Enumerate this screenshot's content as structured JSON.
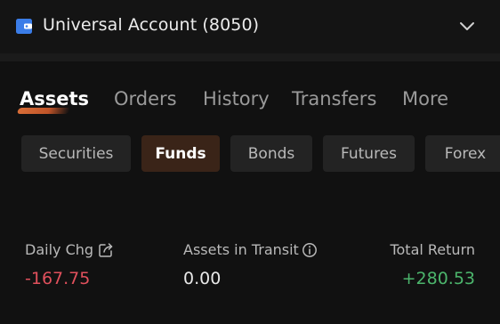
{
  "header": {
    "account_title": "Universal Account (8050)",
    "icons": {
      "wallet": "wallet-icon",
      "expand": "chevron-down-icon"
    },
    "accent_color": "#3b7de8"
  },
  "tabs": [
    {
      "label": "Assets",
      "active": true
    },
    {
      "label": "Orders",
      "active": false
    },
    {
      "label": "History",
      "active": false
    },
    {
      "label": "Transfers",
      "active": false
    },
    {
      "label": "More",
      "active": false
    }
  ],
  "categories": [
    {
      "label": "Securities",
      "active": false
    },
    {
      "label": "Funds",
      "active": true
    },
    {
      "label": "Bonds",
      "active": false
    },
    {
      "label": "Futures",
      "active": false
    },
    {
      "label": "Forex",
      "active": false
    }
  ],
  "stats": {
    "daily_chg": {
      "label": "Daily Chg",
      "value": "-167.75",
      "icon": "share-icon",
      "color": "#e0505c"
    },
    "assets_in_transit": {
      "label": "Assets in Transit",
      "value": "0.00",
      "icon": "info-icon"
    },
    "total_return": {
      "label": "Total Return",
      "value": "+280.53",
      "color": "#4cb56c"
    }
  },
  "colors": {
    "background": "#111111",
    "active_tab_underline": "#e3733a",
    "active_chip_bg": "#3a2418"
  }
}
